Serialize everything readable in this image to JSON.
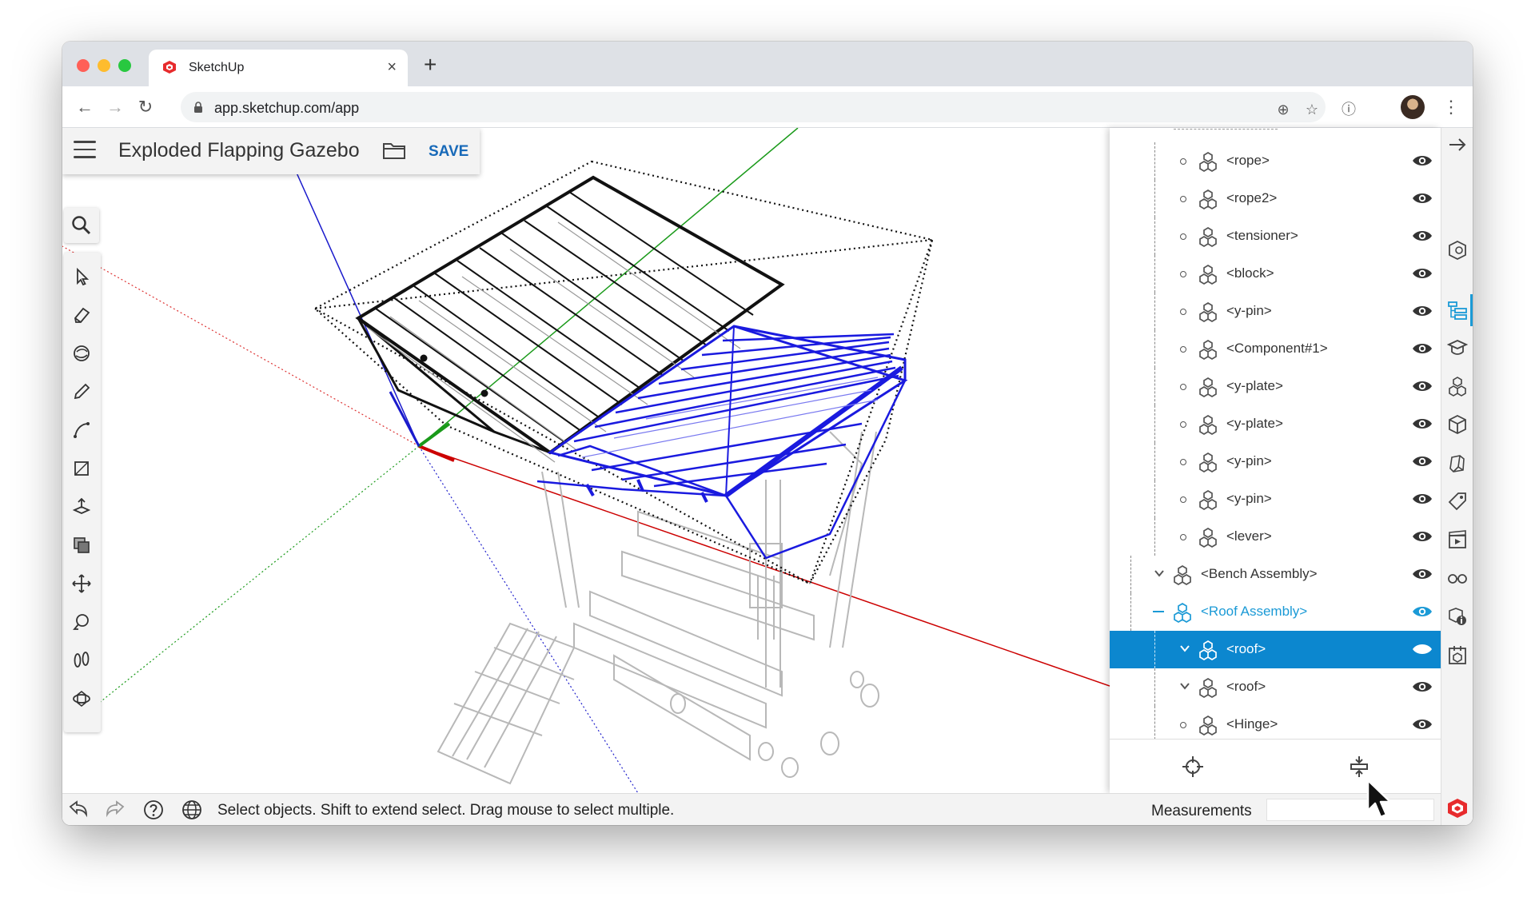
{
  "browser": {
    "tab_title": "SketchUp",
    "url": "app.sketchup.com/app"
  },
  "app": {
    "model_title": "Exploded Flapping Gazebo",
    "save_label": "SAVE"
  },
  "tools": [
    "search-icon",
    "select-icon",
    "eraser-icon",
    "paint-bucket-icon",
    "pencil-icon",
    "arc-icon",
    "rectangle-icon",
    "push-pull-icon",
    "offset-icon",
    "move-icon",
    "tape-measure-icon",
    "walk-icon",
    "orbit-icon"
  ],
  "outliner": {
    "rows": [
      {
        "label": "<rope>",
        "kind": "leaf"
      },
      {
        "label": "<rope2>",
        "kind": "leaf"
      },
      {
        "label": "<tensioner>",
        "kind": "leaf"
      },
      {
        "label": "<block>",
        "kind": "leaf"
      },
      {
        "label": "<y-pin>",
        "kind": "leaf"
      },
      {
        "label": "<Component#1>",
        "kind": "leaf"
      },
      {
        "label": "<y-plate>",
        "kind": "leaf"
      },
      {
        "label": "<y-plate>",
        "kind": "leaf"
      },
      {
        "label": "<y-pin>",
        "kind": "leaf"
      },
      {
        "label": "<y-pin>",
        "kind": "leaf"
      },
      {
        "label": "<lever>",
        "kind": "leaf"
      },
      {
        "label": "<Bench Assembly>",
        "kind": "expanded-top"
      },
      {
        "label": "<Roof Assembly>",
        "kind": "collapsed-blue"
      },
      {
        "label": "<roof>",
        "kind": "expanded-selected"
      },
      {
        "label": "<roof>",
        "kind": "expanded"
      },
      {
        "label": "<Hinge>",
        "kind": "leaf"
      }
    ]
  },
  "tray_icons": [
    "collapse-arrow-icon",
    "entity-info-icon",
    "outliner-icon",
    "instructor-icon",
    "components-icon",
    "materials-icon",
    "styles-icon",
    "tags-icon",
    "scenes-icon",
    "display-icon",
    "model-info-icon",
    "solid-inspector-icon"
  ],
  "status": {
    "message": "Select objects. Shift to extend select. Drag mouse to select multiple.",
    "measurements_label": "Measurements",
    "measurements_value": ""
  },
  "colors": {
    "selection_blue": "#0c87cf",
    "accent_blue": "#1b9ad6",
    "save_blue": "#1769b8",
    "model_blue": "#1a1adf"
  }
}
